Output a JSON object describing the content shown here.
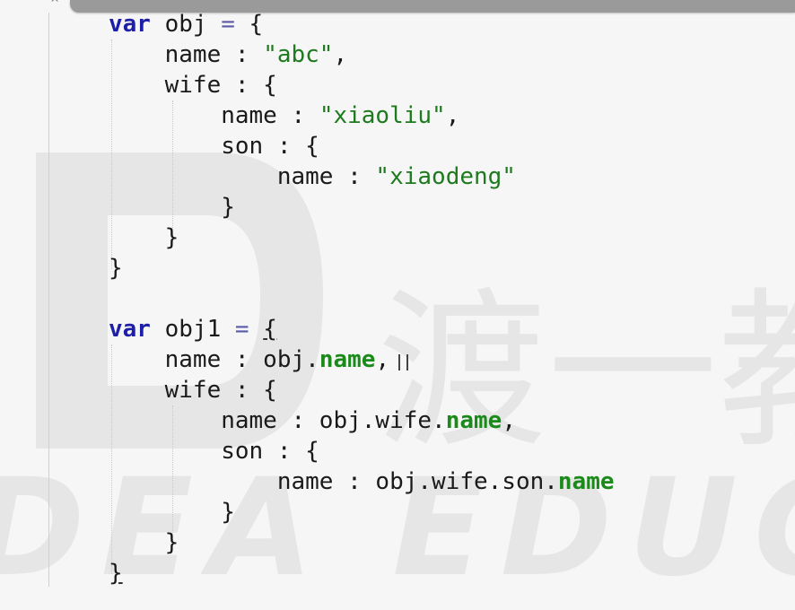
{
  "editor": {
    "top_mark": "^",
    "lines": [
      {
        "tokens": [
          {
            "t": "var",
            "c": "kw"
          },
          {
            "t": " obj "
          },
          {
            "t": "=",
            "c": "op"
          },
          {
            "t": " {"
          }
        ]
      },
      {
        "tokens": [
          {
            "t": "    name : "
          },
          {
            "t": "\"abc\"",
            "c": "str"
          },
          {
            "t": ","
          }
        ]
      },
      {
        "tokens": [
          {
            "t": "    wife : {"
          }
        ]
      },
      {
        "tokens": [
          {
            "t": "        name : "
          },
          {
            "t": "\"xiaoliu\"",
            "c": "str"
          },
          {
            "t": ","
          }
        ]
      },
      {
        "tokens": [
          {
            "t": "        son : {"
          }
        ]
      },
      {
        "tokens": [
          {
            "t": "            name : "
          },
          {
            "t": "\"xiaodeng\"",
            "c": "str"
          }
        ]
      },
      {
        "tokens": [
          {
            "t": "        }"
          }
        ]
      },
      {
        "tokens": [
          {
            "t": "    }"
          }
        ]
      },
      {
        "tokens": [
          {
            "t": "}"
          }
        ]
      },
      {
        "tokens": [
          {
            "t": ""
          }
        ]
      },
      {
        "tokens": [
          {
            "t": "var",
            "c": "kw"
          },
          {
            "t": " obj1 "
          },
          {
            "t": "=",
            "c": "op"
          },
          {
            "t": " "
          },
          {
            "t": "{",
            "c": "underline"
          }
        ]
      },
      {
        "tokens": [
          {
            "t": "    name : obj."
          },
          {
            "t": "name",
            "c": "prop"
          },
          {
            "t": ","
          }
        ]
      },
      {
        "tokens": [
          {
            "t": "    wife : {"
          }
        ]
      },
      {
        "tokens": [
          {
            "t": "        name : obj.wife."
          },
          {
            "t": "name",
            "c": "prop"
          },
          {
            "t": ","
          }
        ]
      },
      {
        "tokens": [
          {
            "t": "        son : {"
          }
        ]
      },
      {
        "tokens": [
          {
            "t": "            name : obj.wife.son."
          },
          {
            "t": "name",
            "c": "prop"
          }
        ]
      },
      {
        "tokens": [
          {
            "t": "        }"
          }
        ]
      },
      {
        "tokens": [
          {
            "t": "    }"
          }
        ]
      },
      {
        "tokens": [
          {
            "t": "}",
            "c": "underline"
          }
        ]
      }
    ]
  },
  "watermark": {
    "text_latin": "DEA EDUCA",
    "text_cjk": "渡一教",
    "color": "#e4e4e4"
  },
  "colors": {
    "keyword": "#1d1fa8",
    "string": "#1f7a1f",
    "property": "#1a8a1a",
    "background": "#f6f6f6"
  }
}
